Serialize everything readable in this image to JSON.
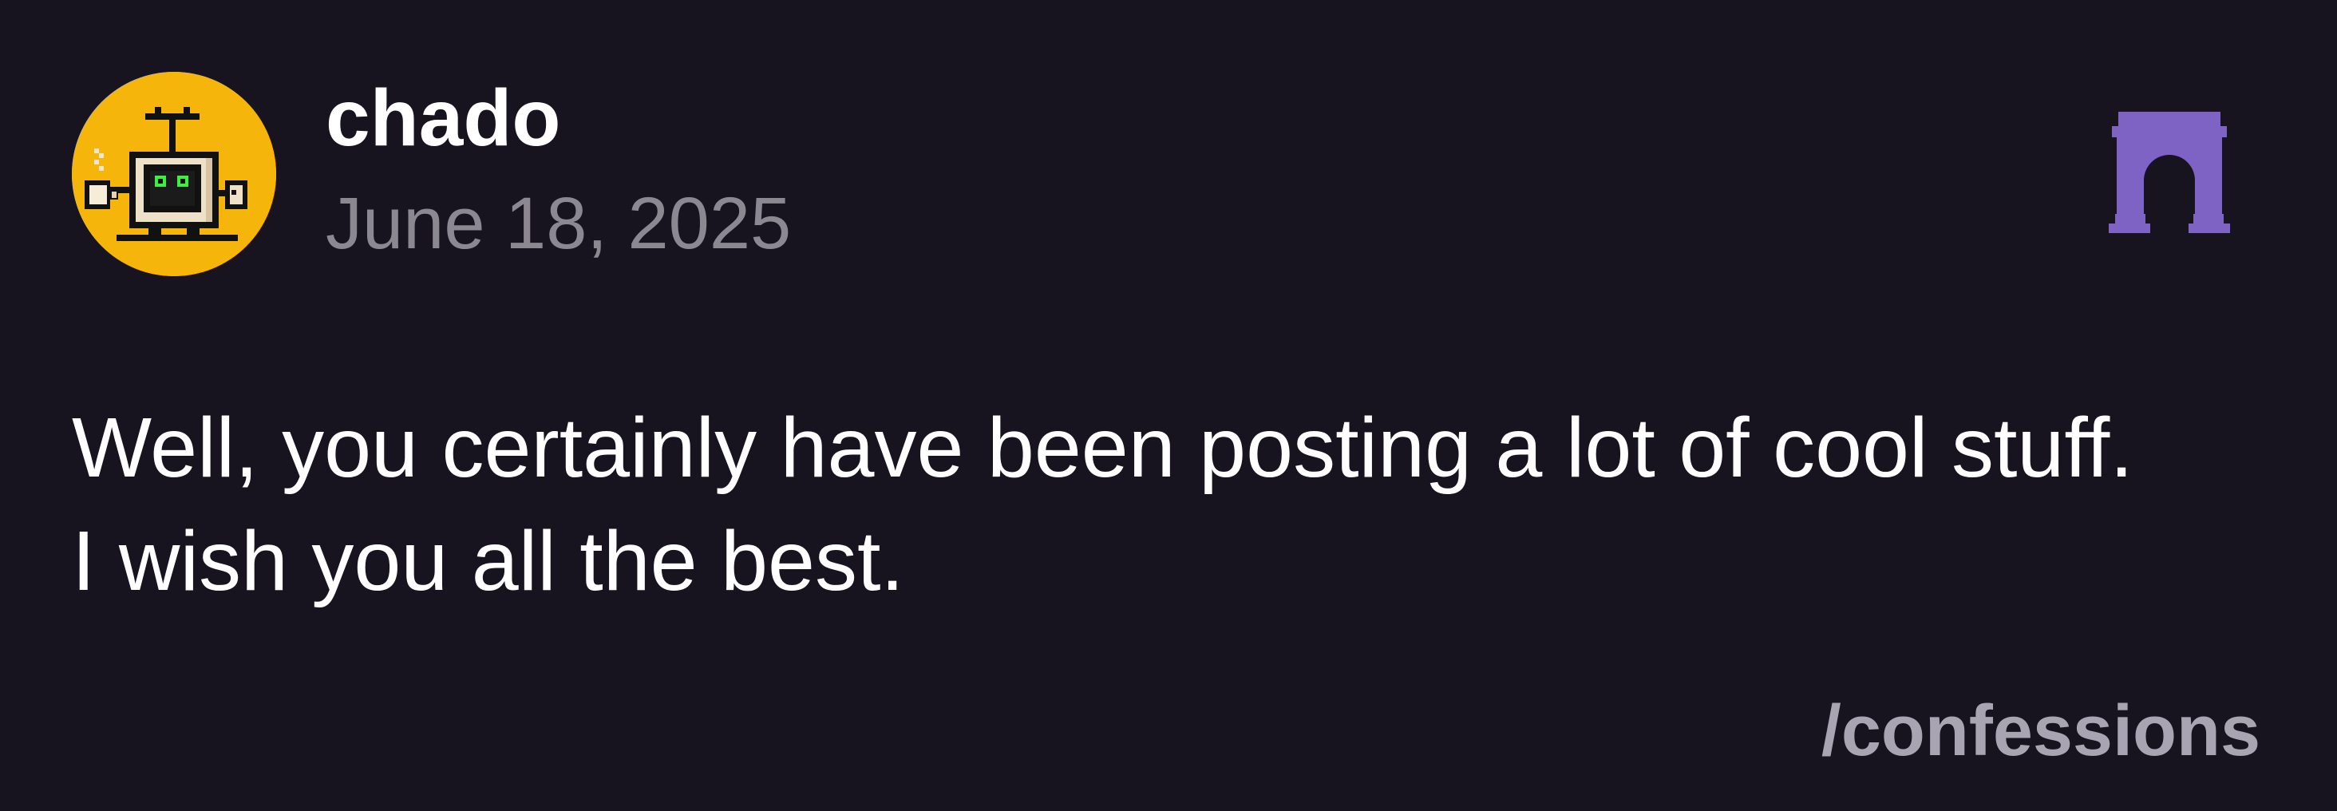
{
  "post": {
    "author": {
      "username": "chado",
      "avatar_icon": "pixel-robot-avatar-icon",
      "avatar_bg": "#f5b50a"
    },
    "date": "June 18, 2025",
    "message_lines": [
      "Well, you certainly have been posting a lot of cool stuff.",
      "I wish you all the best."
    ],
    "channel": "/confessions",
    "channel_icon": "archway-icon",
    "channel_icon_color": "#7e63c4"
  },
  "colors": {
    "background": "#17131f",
    "text_primary": "#ffffff",
    "text_muted": "#8c8891",
    "channel_text": "#a8a4b2"
  }
}
